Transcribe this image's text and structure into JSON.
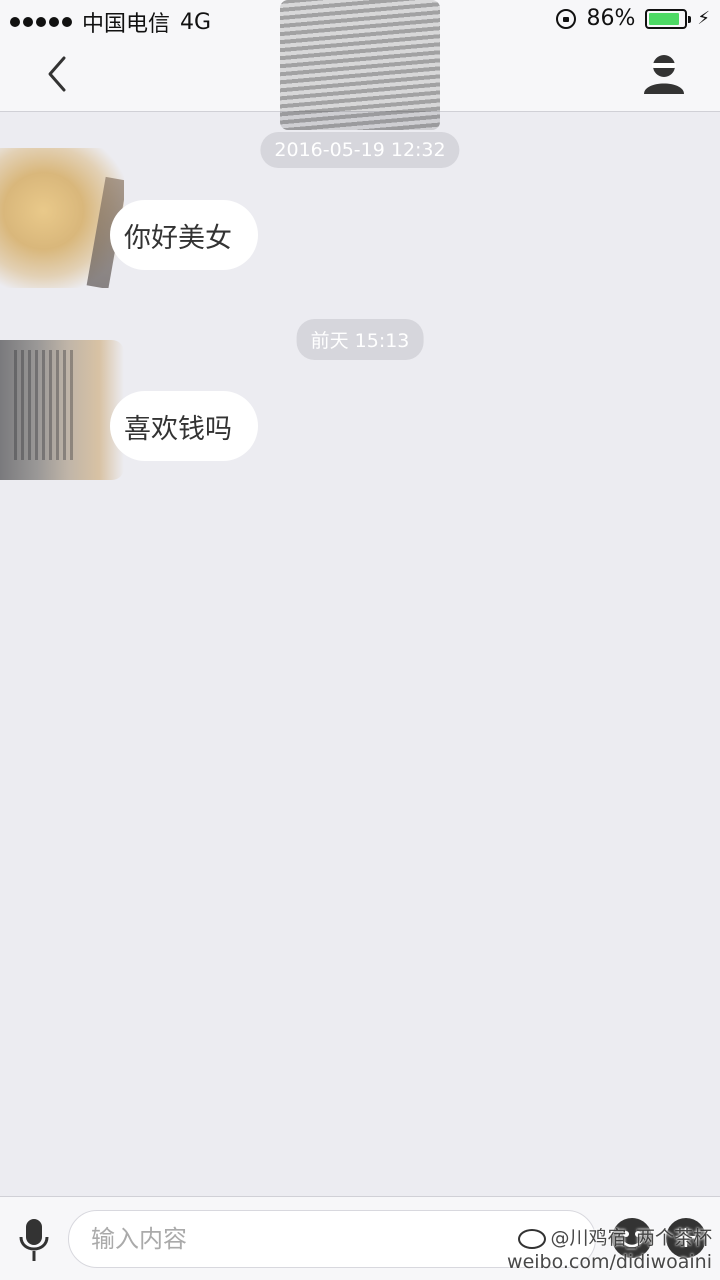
{
  "status_bar": {
    "carrier": "中国电信",
    "network": "4G",
    "battery_percent": "86%",
    "battery_level": 0.86
  },
  "nav": {
    "back_icon": "chevron-left-icon",
    "profile_icon": "person-icon"
  },
  "messages": [
    {
      "timestamp": "2016-05-19 12:32",
      "text": "你好美女"
    },
    {
      "timestamp": "前天 15:13",
      "text": "喜欢钱吗"
    }
  ],
  "input_bar": {
    "placeholder": "输入内容",
    "mic_icon": "microphone-icon",
    "emoji_icon": "emoji-icon",
    "plus_icon": "plus-icon"
  },
  "watermark": {
    "line1": "@川鸡宿_两个茶杯",
    "line2": "weibo.com/didiwoaini"
  },
  "colors": {
    "background": "#ececf1",
    "bubble": "#ffffff",
    "timestamp_pill": "#d6d6dc",
    "battery_green": "#4cd964"
  }
}
